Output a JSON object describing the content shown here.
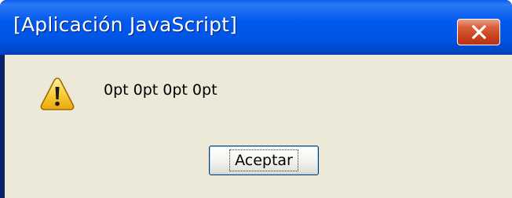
{
  "window": {
    "title": "[Aplicación JavaScript]",
    "close_glyph": "✕"
  },
  "dialog": {
    "icon": "warning-icon",
    "message": "0pt 0pt 0pt 0pt",
    "ok_label": "Aceptar"
  },
  "colors": {
    "titlebar": "#0058ee",
    "client_bg": "#ece9d8",
    "close_button": "#c9401d",
    "warning_fill": "#f5c21b"
  }
}
